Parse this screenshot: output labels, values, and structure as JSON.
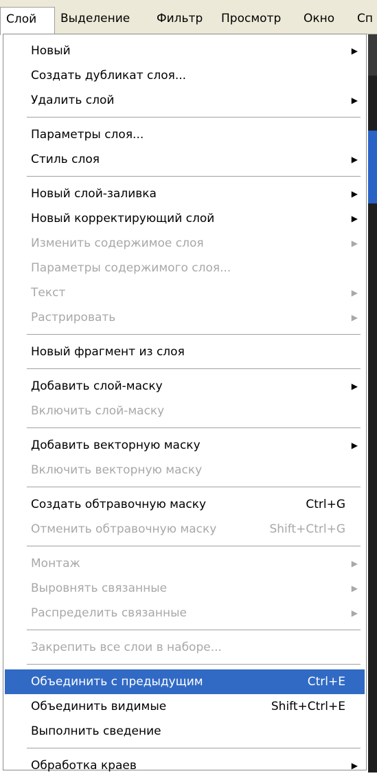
{
  "menubar": {
    "items": [
      "Слой",
      "Выделение",
      "Фильтр",
      "Просмотр",
      "Окно",
      "Сп"
    ]
  },
  "menu": {
    "groups": [
      [
        {
          "label": "Новый",
          "submenu": true
        },
        {
          "label": "Создать дубликат слоя..."
        },
        {
          "label": "Удалить слой",
          "submenu": true
        }
      ],
      [
        {
          "label": "Параметры слоя..."
        },
        {
          "label": "Стиль слоя",
          "submenu": true
        }
      ],
      [
        {
          "label": "Новый слой-заливка",
          "submenu": true
        },
        {
          "label": "Новый корректирующий слой",
          "submenu": true
        },
        {
          "label": "Изменить содержимое слоя",
          "submenu": true,
          "disabled": true
        },
        {
          "label": "Параметры содержимого слоя...",
          "disabled": true
        },
        {
          "label": "Текст",
          "submenu": true,
          "disabled": true
        },
        {
          "label": "Растрировать",
          "submenu": true,
          "disabled": true
        }
      ],
      [
        {
          "label": "Новый фрагмент из слоя"
        }
      ],
      [
        {
          "label": "Добавить слой-маску",
          "submenu": true
        },
        {
          "label": "Включить слой-маску",
          "disabled": true
        }
      ],
      [
        {
          "label": "Добавить векторную маску",
          "submenu": true
        },
        {
          "label": "Включить векторную маску",
          "disabled": true
        }
      ],
      [
        {
          "label": "Создать обтравочную маску",
          "shortcut": "Ctrl+G"
        },
        {
          "label": "Отменить обтравочную маску",
          "shortcut": "Shift+Ctrl+G",
          "disabled": true
        }
      ],
      [
        {
          "label": "Монтаж",
          "submenu": true,
          "disabled": true
        },
        {
          "label": "Выровнять связанные",
          "submenu": true,
          "disabled": true
        },
        {
          "label": "Распределить связанные",
          "submenu": true,
          "disabled": true
        }
      ],
      [
        {
          "label": "Закрепить все слои в наборе...",
          "disabled": true
        }
      ],
      [
        {
          "label": "Объединить с предыдущим",
          "shortcut": "Ctrl+E",
          "highlighted": true
        },
        {
          "label": "Объединить видимые",
          "shortcut": "Shift+Ctrl+E"
        },
        {
          "label": "Выполнить сведение"
        }
      ],
      [
        {
          "label": "Обработка краев",
          "submenu": true
        }
      ]
    ]
  },
  "icons": {
    "submenu_arrow": "▶"
  },
  "colors": {
    "highlight": "#316ac5",
    "disabled_text": "#a8a8a8",
    "menubar_bg": "#ece9d8"
  }
}
